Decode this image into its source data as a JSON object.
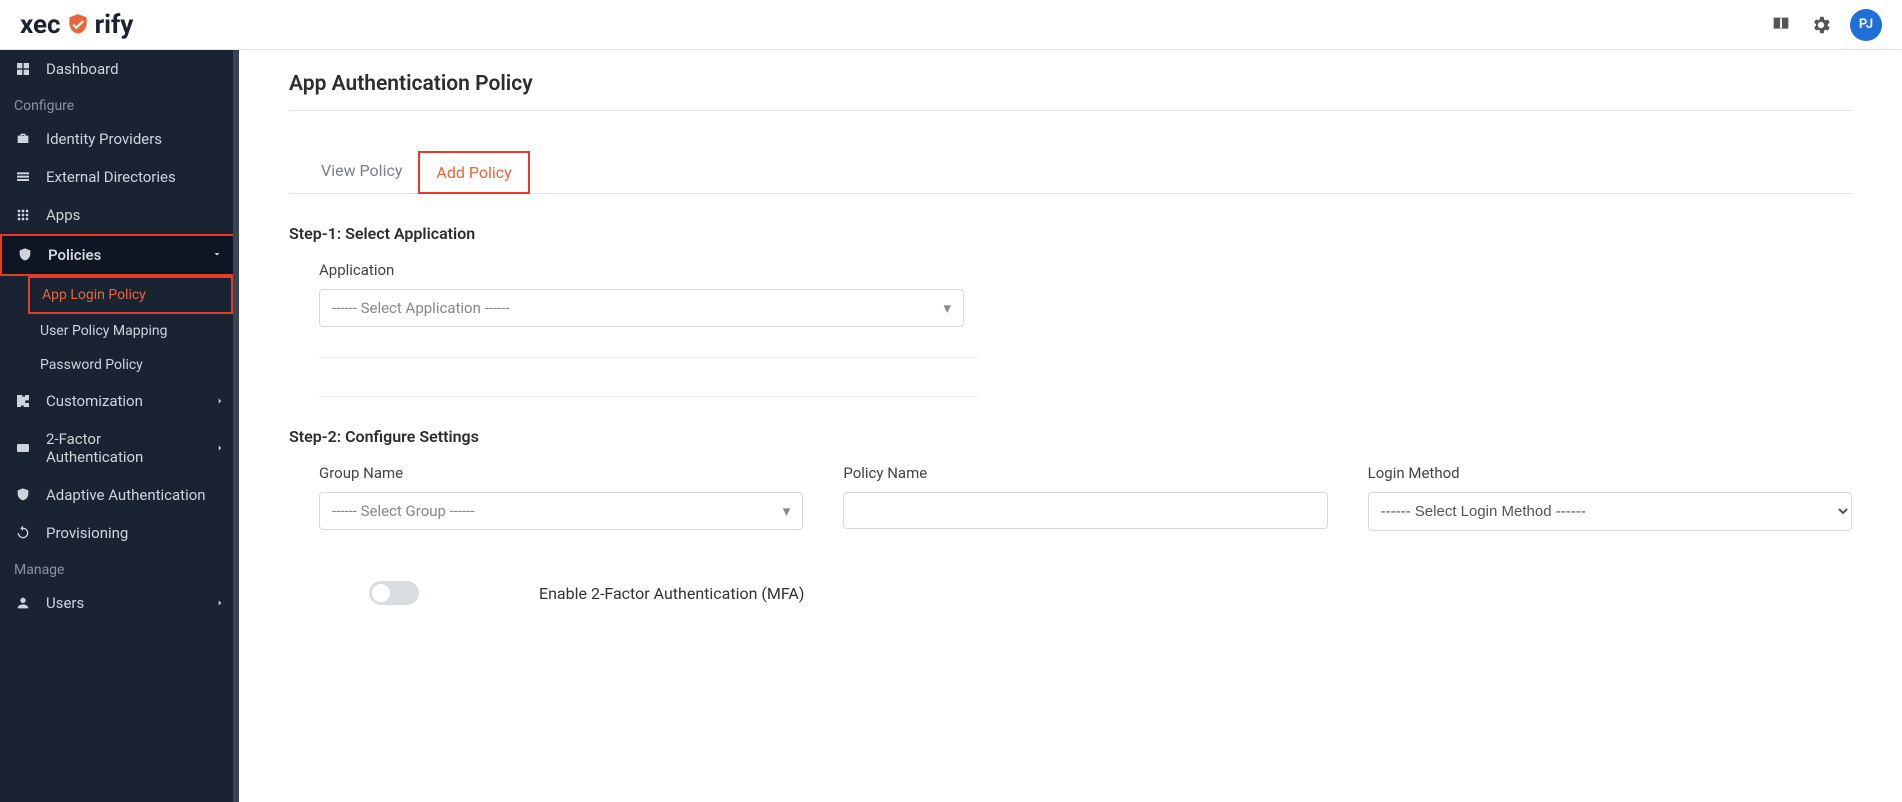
{
  "brand": {
    "part1": "xec",
    "part2": "rify"
  },
  "header": {
    "avatar_initials": "PJ"
  },
  "sidebar": {
    "dashboard": "Dashboard",
    "section_configure": "Configure",
    "identity_providers": "Identity Providers",
    "external_directories": "External Directories",
    "apps": "Apps",
    "policies": "Policies",
    "policies_children": {
      "app_login_policy": "App Login Policy",
      "user_policy_mapping": "User Policy Mapping",
      "password_policy": "Password Policy"
    },
    "customization": "Customization",
    "two_factor": "2-Factor Authentication",
    "adaptive_auth": "Adaptive Authentication",
    "provisioning": "Provisioning",
    "section_manage": "Manage",
    "users": "Users"
  },
  "page": {
    "title": "App Authentication Policy",
    "tabs": {
      "view": "View Policy",
      "add": "Add Policy"
    },
    "step1": {
      "title": "Step-1: Select Application",
      "label_application": "Application",
      "application_placeholder": "------ Select Application ------"
    },
    "step2": {
      "title": "Step-2: Configure Settings",
      "label_group": "Group Name",
      "group_placeholder": "------ Select Group ------",
      "label_policy": "Policy Name",
      "label_login_method": "Login Method",
      "login_method_placeholder": "------ Select Login Method ------",
      "toggle_label": "Enable 2-Factor Authentication (MFA)"
    }
  }
}
